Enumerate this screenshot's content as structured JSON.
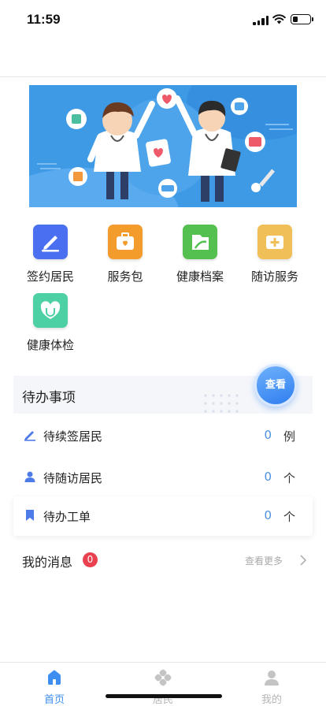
{
  "status_bar": {
    "time": "11:59",
    "battery_level": 0.3
  },
  "grid": [
    {
      "label": "签约居民",
      "icon": "pen-icon",
      "color": "#4a6ff0"
    },
    {
      "label": "服务包",
      "icon": "medical-bag-icon",
      "color": "#f39c2c"
    },
    {
      "label": "健康档案",
      "icon": "folder-icon",
      "color": "#53c04f"
    },
    {
      "label": "随访服务",
      "icon": "medical-box-icon",
      "color": "#f0bf58"
    },
    {
      "label": "健康体检",
      "icon": "heart-stethoscope-icon",
      "color": "#4cd0a4"
    }
  ],
  "todo": {
    "title": "待办事项",
    "view_label": "查看",
    "rows": [
      {
        "label": "待续签居民",
        "count": "0",
        "unit": "例",
        "icon": "pen-icon"
      },
      {
        "label": "待随访居民",
        "count": "0",
        "unit": "个",
        "icon": "person-icon"
      },
      {
        "label": "待办工单",
        "count": "0",
        "unit": "个",
        "icon": "bookmark-icon"
      }
    ]
  },
  "messages": {
    "title": "我的消息",
    "badge": "0",
    "more_label": "查看更多"
  },
  "tab_bar": {
    "active_color": "#3d8ef0",
    "inactive_color": "#b5b5b5",
    "tabs": [
      {
        "label": "首页",
        "icon": "home-icon",
        "active": true
      },
      {
        "label": "居民",
        "icon": "clover-icon",
        "active": false
      },
      {
        "label": "我的",
        "icon": "user-icon",
        "active": false
      }
    ]
  }
}
